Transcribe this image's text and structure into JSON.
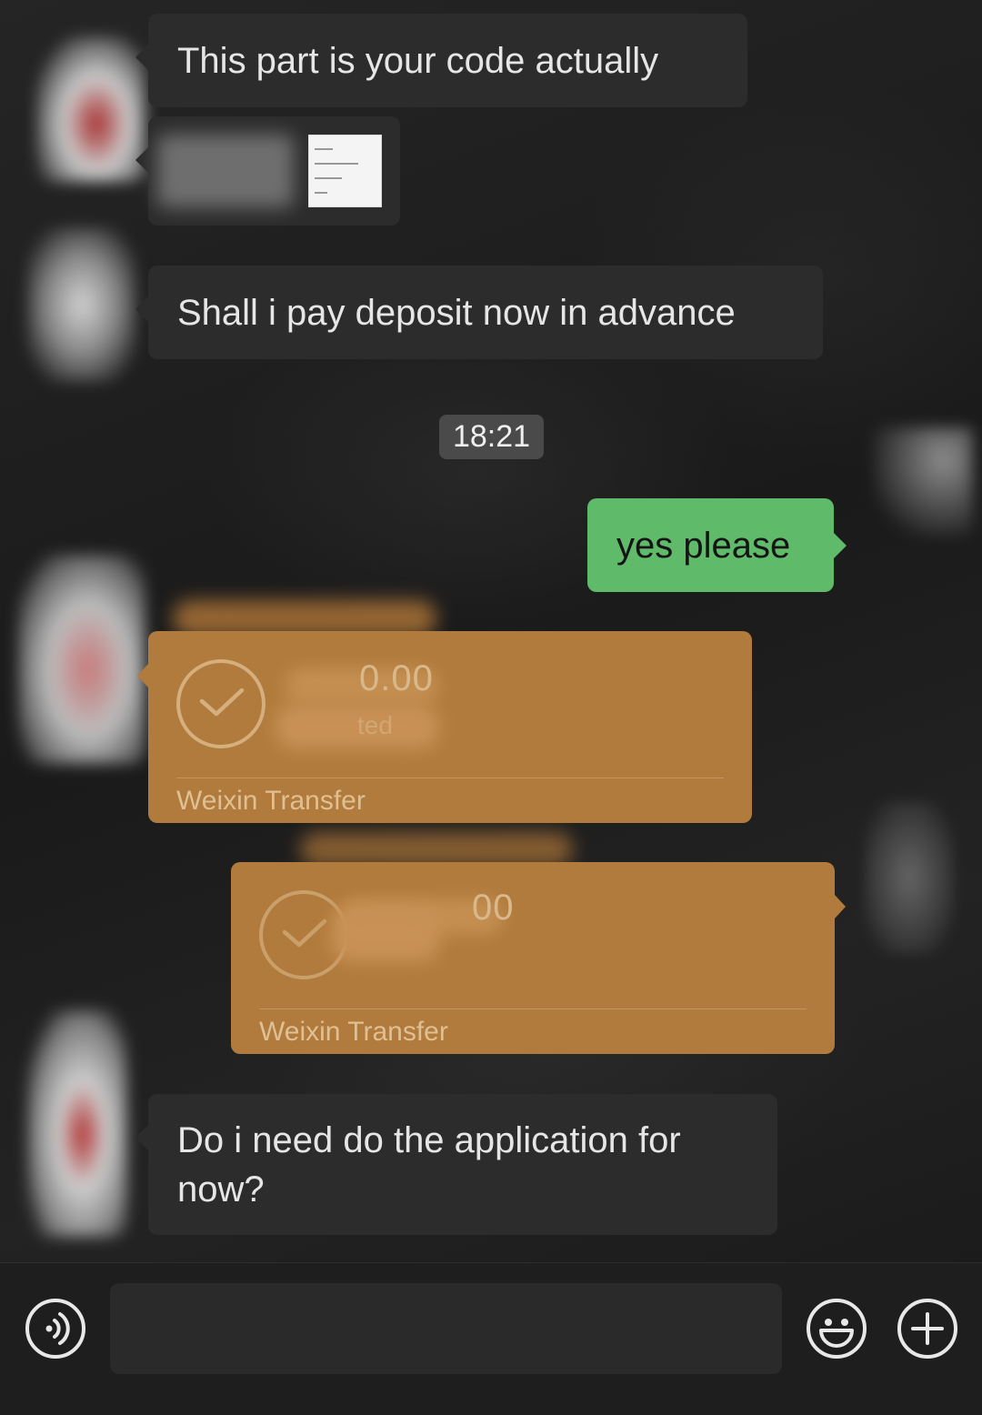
{
  "messages": {
    "m1": "This part is your code actually",
    "m3": "Shall i pay deposit now in advance",
    "timestamp": "18:21",
    "m4": "yes please",
    "m6": "Do i need do the application for now?"
  },
  "transfers": [
    {
      "amount": "0.00",
      "status": "ted",
      "label": "Weixin Transfer"
    },
    {
      "amount": "00",
      "label": "Weixin Transfer"
    }
  ],
  "input_bar": {
    "voice_icon": "voice-icon",
    "emoji_icon": "emoji-icon",
    "plus_icon": "plus-icon",
    "text_value": ""
  },
  "colors": {
    "sent_bubble": "#5fba6a",
    "received_bubble": "#2c2c2c",
    "transfer_card": "#b07b3c",
    "background": "#1b1b1b"
  }
}
